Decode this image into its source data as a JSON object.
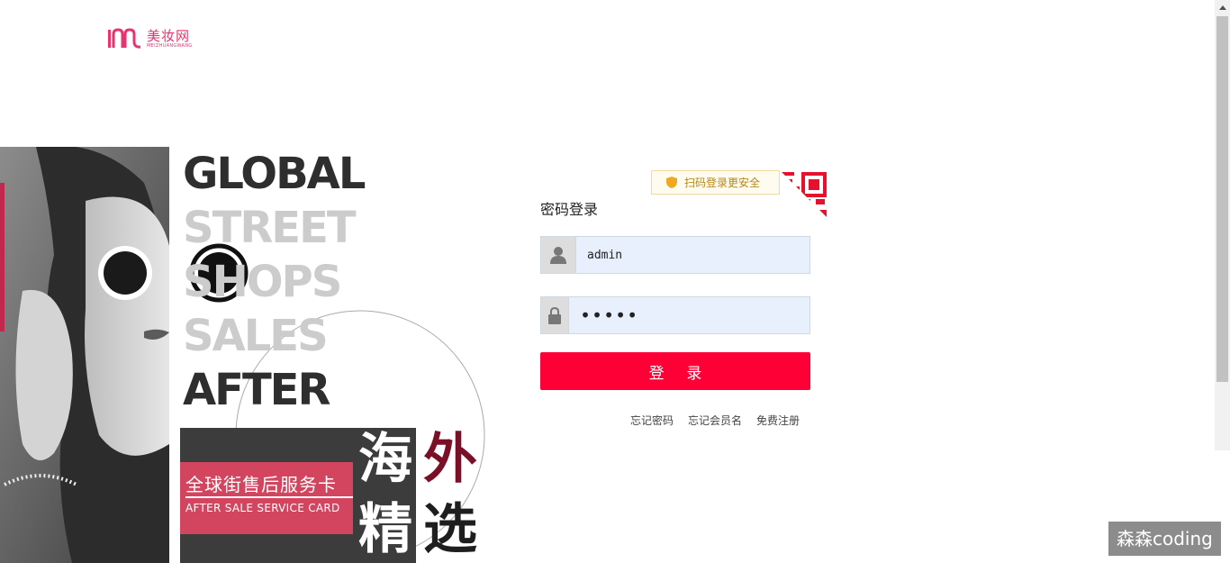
{
  "logo": {
    "cn": "美妆网",
    "en": "MEIZHUANGWANG"
  },
  "banner": {
    "lines": [
      "GLOBAL",
      "STREET",
      "SHOPS",
      "SALES",
      "AFTER"
    ],
    "card_cn": "全球街售后服务卡",
    "card_en": "AFTER SALE SERVICE CARD",
    "chars": [
      "海",
      "外",
      "精",
      "选"
    ]
  },
  "login": {
    "qr_tip": "扫码登录更安全",
    "title": "密码登录",
    "username": {
      "value": "admin",
      "icon": "user-icon"
    },
    "password": {
      "value": "•••••",
      "icon": "lock-icon"
    },
    "submit_label": "登 录",
    "links": [
      "忘记密码",
      "忘记会员名",
      "免费注册"
    ]
  },
  "colors": {
    "brand": "#e8336e",
    "primary_button": "#ff0036",
    "input_bg": "#e8f0fe"
  },
  "watermark": "森森coding"
}
